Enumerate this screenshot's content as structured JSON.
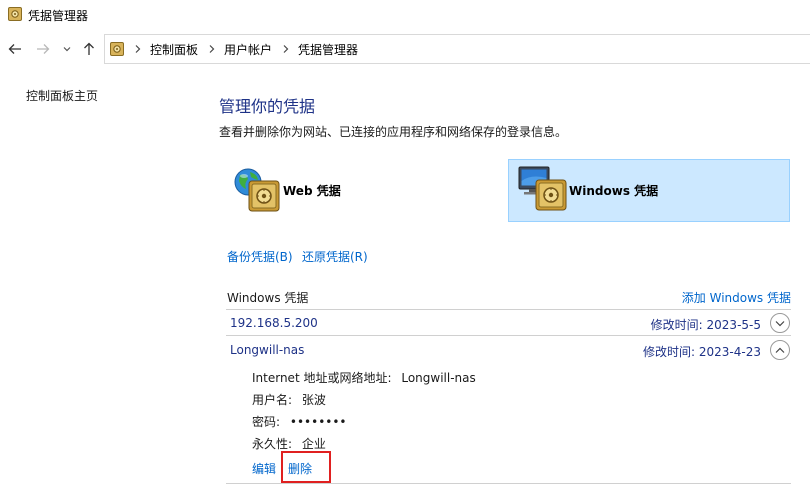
{
  "window": {
    "title": "凭据管理器",
    "icon": "vault-icon"
  },
  "navigation": {
    "back_icon": "arrow-left-icon",
    "forward_icon": "arrow-right-icon",
    "recent_icon": "chevron-down-icon",
    "up_icon": "arrow-up-icon",
    "breadcrumbs": [
      "控制面板",
      "用户帐户",
      "凭据管理器"
    ]
  },
  "sidebar": {
    "home_link": "控制面板主页"
  },
  "main": {
    "title": "管理你的凭据",
    "description": "查看并删除你为网站、已连接的应用程序和网络保存的登录信息。",
    "tiles": [
      {
        "label": "Web 凭据",
        "icon": "globe-safe-icon",
        "selected": false
      },
      {
        "label": "Windows 凭据",
        "icon": "computer-safe-icon",
        "selected": true
      }
    ],
    "backup_link": "备份凭据(B)",
    "restore_link": "还原凭据(R)",
    "section_title": "Windows 凭据",
    "add_link": "添加 Windows 凭据",
    "credentials": [
      {
        "name": "192.168.5.200",
        "modified": "修改时间:  2023-5-5",
        "expanded": false
      },
      {
        "name": "Longwill-nas",
        "modified": "修改时间:  2023-4-23",
        "expanded": true,
        "details": {
          "address_label": "Internet 地址或网络地址:",
          "address_value": "Longwill-nas",
          "user_label": "用户名:",
          "user_value": "张波",
          "password_label": "密码:",
          "password_value": "••••••••",
          "persistence_label": "永久性:",
          "persistence_value": "企业"
        },
        "edit_link": "编辑",
        "delete_link": "删除"
      }
    ]
  },
  "colors": {
    "accent_link": "#0066cc",
    "title_blue": "#1e3287",
    "selected_tile_bg": "#cce8ff",
    "highlight_box": "#e02020"
  }
}
